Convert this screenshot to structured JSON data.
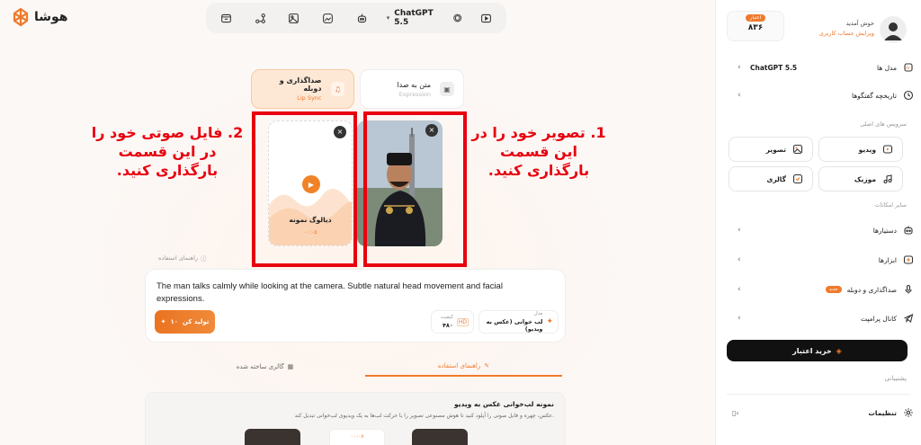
{
  "app": {
    "logo_text": "هوشا",
    "brand_color": "#ef7a2c",
    "annotation_color": "#e8000f"
  },
  "toolbar": {
    "icons": [
      "folder-icon",
      "workflow-icon",
      "image-gen-icon",
      "image-edit-icon",
      "robot-icon"
    ],
    "model_label": "ChatGPT 5.5",
    "model_icon": "openai-icon",
    "extra_icon": "video-play-icon"
  },
  "mode_tabs": {
    "active": {
      "title": "صداگذاری و دوبله",
      "sub": "Lip Sync"
    },
    "inactive": {
      "title": "متن به صدا",
      "sub": "Expression"
    }
  },
  "upload": {
    "dialog_title": "دیالوگ نمونه",
    "dialog_time": "۰۰:۰۵",
    "close_label": "×"
  },
  "annotations": {
    "right": "1. تصویر خود را در این قسمت بارگذاری کنید.",
    "left": "2. فایل صوتی خود را در این قسمت بارگذاری کنید."
  },
  "guide_link": "راهنمای استفاده",
  "prompt": {
    "text": "The man talks calmly while looking at the camera. Subtle natural head movement and facial expressions.",
    "generate_label": "تولید کن",
    "generate_cost": "۱۰",
    "model_caption": "مدل",
    "model_value": "لب خوانی (عکس به ویدیو)",
    "quality_caption": "کیفیت",
    "quality_value": "۴۸۰"
  },
  "bottom_tabs": {
    "guide": "راهنمای استفاده",
    "gallery": "گالری ساخته شده"
  },
  "guide_panel": {
    "title": "نمونه لب‌خوانی عکس به ویدیو",
    "desc": "عکس، چهره و فایل صوتی را آپلود کنید تا هوش مصنوعی تصویر را با حرکت لب‌ها به یک ویدیوی لب‌خوانی تبدیل کند.",
    "time_badge": "۰۰:۰۸"
  },
  "sidebar": {
    "welcome": "خوش آمدید",
    "edit_account": "ویرایش حساب کاربری",
    "credit_badge": "اعتبار",
    "credit_value": "۸۳۶",
    "models_label": "مدل ها",
    "models_value": "ChatGPT 5.5",
    "history_label": "تاریخچه گفتگوها",
    "main_services": "سرویس های اصلی",
    "services": {
      "video": "ویدیو",
      "image": "تصویر",
      "music": "موزیک",
      "gallery": "گالری"
    },
    "other_features": "سایر امکانات",
    "assistants": "دستیارها",
    "tools": "ابزارها",
    "dubbing": "صداگذاری و دوبله",
    "new_badge": "جدید",
    "prompt_channel": "کانال پرامپت",
    "buy_credit": "خرید اعتبار",
    "support": "پشتیبانی",
    "settings": "تنظیمات"
  }
}
